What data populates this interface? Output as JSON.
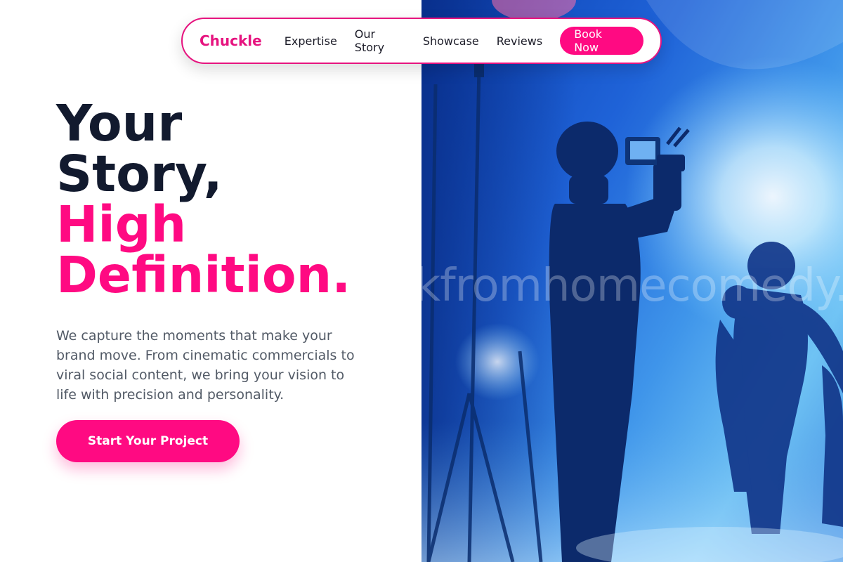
{
  "nav": {
    "brand": "Chuckle",
    "links": [
      "Expertise",
      "Our Story",
      "Showcase",
      "Reviews"
    ],
    "cta_label": "Book Now"
  },
  "hero": {
    "title_line1": "Your",
    "title_line2": "Story,",
    "title_line3": "High",
    "title_line4": "Definition.",
    "description": "We capture the moments that make your brand move. From cinematic commercials to viral social content, we bring your vision to life with precision and personality.",
    "cta_label": "Start Your Project"
  },
  "photo": {
    "watermark": "kfromhomecomedy.c"
  },
  "colors": {
    "accent": "#ff0a82",
    "heading": "#121a2e",
    "body_text": "#525a66",
    "photo_blue": "#1f63d8"
  }
}
